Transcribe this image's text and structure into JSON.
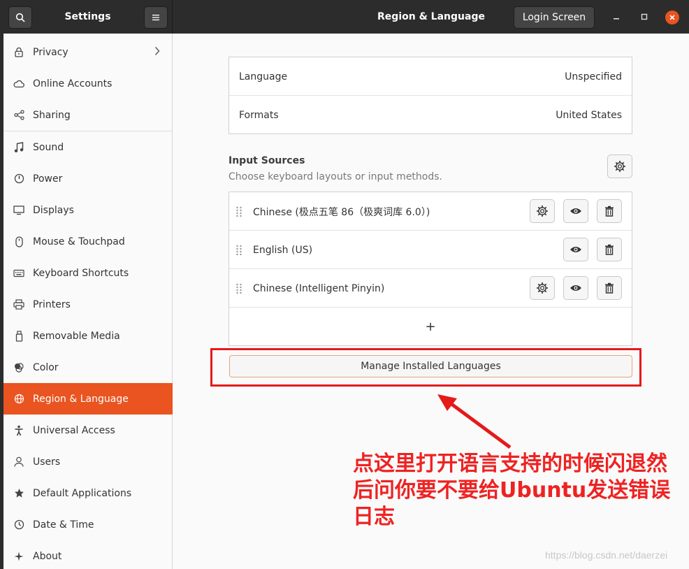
{
  "titlebar": {
    "app_title": "Settings",
    "page_title": "Region & Language",
    "login_button": "Login Screen",
    "search_icon": "search-icon",
    "menu_icon": "hamburger-menu-icon"
  },
  "sidebar": {
    "items": [
      {
        "label": "Privacy",
        "icon": "lock-icon"
      },
      {
        "label": "Online Accounts",
        "icon": "cloud-icon"
      },
      {
        "label": "Sharing",
        "icon": "share-icon"
      },
      {
        "label": "Sound",
        "icon": "music-note-icon"
      },
      {
        "label": "Power",
        "icon": "power-icon"
      },
      {
        "label": "Displays",
        "icon": "display-icon"
      },
      {
        "label": "Mouse & Touchpad",
        "icon": "mouse-icon"
      },
      {
        "label": "Keyboard Shortcuts",
        "icon": "keyboard-icon"
      },
      {
        "label": "Printers",
        "icon": "printer-icon"
      },
      {
        "label": "Removable Media",
        "icon": "usb-drive-icon"
      },
      {
        "label": "Color",
        "icon": "color-icon"
      },
      {
        "label": "Region & Language",
        "icon": "globe-icon"
      },
      {
        "label": "Universal Access",
        "icon": "accessibility-icon"
      },
      {
        "label": "Users",
        "icon": "user-icon"
      },
      {
        "label": "Default Applications",
        "icon": "star-icon"
      },
      {
        "label": "Date & Time",
        "icon": "clock-icon"
      },
      {
        "label": "About",
        "icon": "sparkle-icon"
      }
    ],
    "active": "Region & Language"
  },
  "language_settings": {
    "language_label": "Language",
    "language_value": "Unspecified",
    "formats_label": "Formats",
    "formats_value": "United States"
  },
  "input_sources": {
    "title": "Input Sources",
    "subtitle": "Choose keyboard layouts or input methods.",
    "sources": [
      {
        "name": "Chinese (极点五笔 86（极爽词库 6.0）)",
        "has_settings": true
      },
      {
        "name": "English (US)",
        "has_settings": false
      },
      {
        "name": "Chinese (Intelligent Pinyin)",
        "has_settings": true
      }
    ],
    "add_label": "+"
  },
  "manage_button": "Manage Installed Languages",
  "annotation": {
    "text": "点这里打开语言支持的时候闪退然后问你要不要给Ubuntu发送错误日志",
    "color": "#ef2222"
  },
  "watermark": "https://blog.csdn.net/daerzei",
  "colors": {
    "accent": "#e95420",
    "titlebar": "#2c2c2c"
  }
}
